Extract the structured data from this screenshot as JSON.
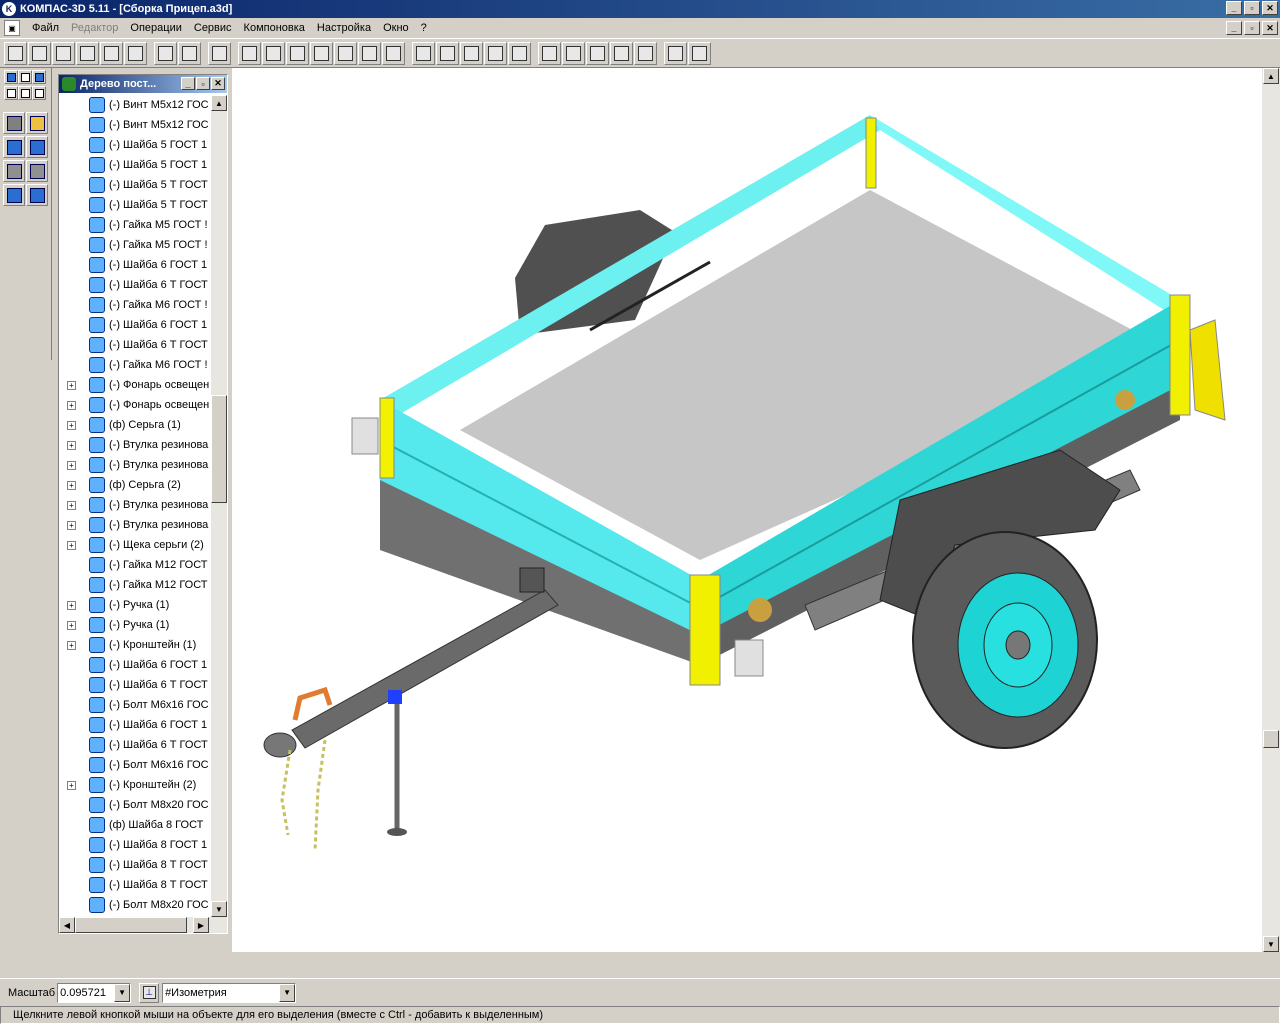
{
  "window": {
    "title": "КОМПАС-3D 5.11 - [Сборка Прицеп.a3d]",
    "min": "_",
    "max": "▫",
    "close": "✕"
  },
  "menu": [
    "Файл",
    "Редактор",
    "Операции",
    "Сервис",
    "Компоновка",
    "Настройка",
    "Окно",
    "?"
  ],
  "panel": {
    "title": "Дерево пост..."
  },
  "tree": [
    {
      "label": "(-) Винт М5х12 ГОС",
      "exp": false
    },
    {
      "label": "(-) Винт М5х12 ГОС",
      "exp": false
    },
    {
      "label": "(-) Шайба 5 ГОСТ 1",
      "exp": false
    },
    {
      "label": "(-) Шайба 5 ГОСТ 1",
      "exp": false
    },
    {
      "label": "(-) Шайба 5 Т ГОСТ",
      "exp": false
    },
    {
      "label": "(-) Шайба 5 Т ГОСТ",
      "exp": false
    },
    {
      "label": "(-) Гайка М5 ГОСТ !",
      "exp": false
    },
    {
      "label": "(-) Гайка М5 ГОСТ !",
      "exp": false
    },
    {
      "label": "(-) Шайба 6 ГОСТ 1",
      "exp": false
    },
    {
      "label": "(-) Шайба 6 Т ГОСТ",
      "exp": false
    },
    {
      "label": "(-) Гайка М6 ГОСТ !",
      "exp": false
    },
    {
      "label": "(-) Шайба 6 ГОСТ 1",
      "exp": false
    },
    {
      "label": "(-) Шайба 6 Т ГОСТ",
      "exp": false
    },
    {
      "label": "(-) Гайка М6 ГОСТ !",
      "exp": false
    },
    {
      "label": "(-) Фонарь освещен",
      "exp": true
    },
    {
      "label": "(-) Фонарь освещен",
      "exp": true
    },
    {
      "label": "(ф) Серьга (1)",
      "exp": true
    },
    {
      "label": "(-) Втулка резинова",
      "exp": true
    },
    {
      "label": "(-) Втулка резинова",
      "exp": true
    },
    {
      "label": "(ф) Серьга (2)",
      "exp": true
    },
    {
      "label": "(-) Втулка резинова",
      "exp": true
    },
    {
      "label": "(-) Втулка резинова",
      "exp": true
    },
    {
      "label": "(-) Щека серьги (2)",
      "exp": true
    },
    {
      "label": "(-) Гайка М12 ГОСТ",
      "exp": false
    },
    {
      "label": "(-) Гайка М12 ГОСТ",
      "exp": false
    },
    {
      "label": "(-) Ручка (1)",
      "exp": true
    },
    {
      "label": "(-) Ручка (1)",
      "exp": true
    },
    {
      "label": "(-) Кронштейн (1)",
      "exp": true
    },
    {
      "label": "(-) Шайба 6 ГОСТ 1",
      "exp": false
    },
    {
      "label": "(-) Шайба 6 Т ГОСТ",
      "exp": false
    },
    {
      "label": "(-) Болт М6х16 ГОС",
      "exp": false
    },
    {
      "label": "(-) Шайба 6 ГОСТ 1",
      "exp": false
    },
    {
      "label": "(-) Шайба 6 Т ГОСТ",
      "exp": false
    },
    {
      "label": "(-) Болт М6х16 ГОС",
      "exp": false
    },
    {
      "label": "(-) Кронштейн (2)",
      "exp": true
    },
    {
      "label": "(-) Болт М8х20 ГОС",
      "exp": false
    },
    {
      "label": "(ф) Шайба 8 ГОСТ",
      "exp": false
    },
    {
      "label": "(-) Шайба 8 ГОСТ 1",
      "exp": false
    },
    {
      "label": "(-) Шайба 8 Т ГОСТ",
      "exp": false
    },
    {
      "label": "(-) Шайба 8 Т ГОСТ",
      "exp": false
    },
    {
      "label": "(-) Болт М8х20 ГОС",
      "exp": false
    }
  ],
  "status": {
    "scale_label": "Масштаб",
    "scale_value": "0.095721",
    "view_value": "#Изометрия",
    "hint": "Щелкните левой кнопкой мыши на объекте для его выделения (вместе с Ctrl - добавить к выделенным)"
  }
}
